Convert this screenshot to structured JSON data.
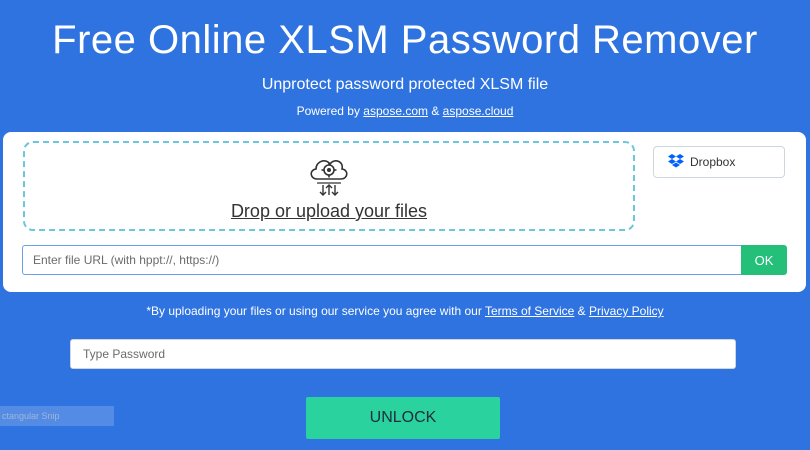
{
  "header": {
    "title": "Free Online XLSM Password Remover",
    "subtitle": "Unprotect password protected XLSM file",
    "powered_prefix": "Powered by ",
    "powered_link1": "aspose.com",
    "powered_amp": " & ",
    "powered_link2": "aspose.cloud"
  },
  "upload": {
    "drop_text": "Drop or upload your files",
    "drop_icon": "cloud-upload-gear-icon",
    "dropbox_label": "Dropbox",
    "url_placeholder": "Enter file URL (with hppt://, https://)",
    "ok_label": "OK"
  },
  "notice": {
    "prefix": "*By uploading your files or using our service you agree with our ",
    "terms": "Terms of Service",
    "amp": " & ",
    "privacy": "Privacy Policy"
  },
  "password": {
    "placeholder": "Type Password",
    "value": ""
  },
  "overlay": {
    "snip_label": "ctangular Snip"
  },
  "action": {
    "unlock_label": "UNLOCK"
  },
  "colors": {
    "background": "#2f73e0",
    "ok_button": "#24c079",
    "unlock_button": "#2ad29d",
    "dropzone_border": "#6cc7dc"
  }
}
